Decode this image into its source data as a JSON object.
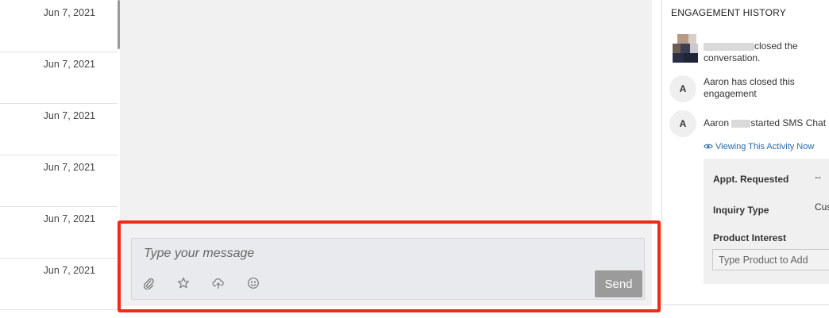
{
  "conversation_list": {
    "dates": [
      "Jun 7, 2021",
      "Jun 7, 2021",
      "Jun 7, 2021",
      "Jun 7, 2021",
      "Jun 7, 2021",
      "Jun 7, 2021"
    ]
  },
  "composer": {
    "placeholder": "Type your message",
    "send_label": "Send",
    "tools": [
      "paperclip-icon",
      "star-icon",
      "cloud-upload-icon",
      "smiley-icon"
    ]
  },
  "engagement_history": {
    "title": "ENGAGEMENT HISTORY",
    "items": [
      {
        "avatar": "",
        "line1": "closed the",
        "line2": "conversation."
      },
      {
        "avatar": "A",
        "line1": "Aaron has closed this",
        "line2": "engagement"
      },
      {
        "avatar": "A",
        "line1_a": "Aaron ",
        "line1_b": "started SMS Chat"
      }
    ],
    "viewing_link": "Viewing This Activity Now",
    "details": {
      "appt_label": "Appt. Requested",
      "appt_value": "--",
      "inquiry_label": "Inquiry Type",
      "inquiry_value": "Cus",
      "product_label": "Product Interest",
      "product_placeholder": "Type Product to Add"
    }
  },
  "colors": {
    "highlight": "#f22a16",
    "send_button": "#9b9b9b",
    "link": "#2a6aa8"
  }
}
